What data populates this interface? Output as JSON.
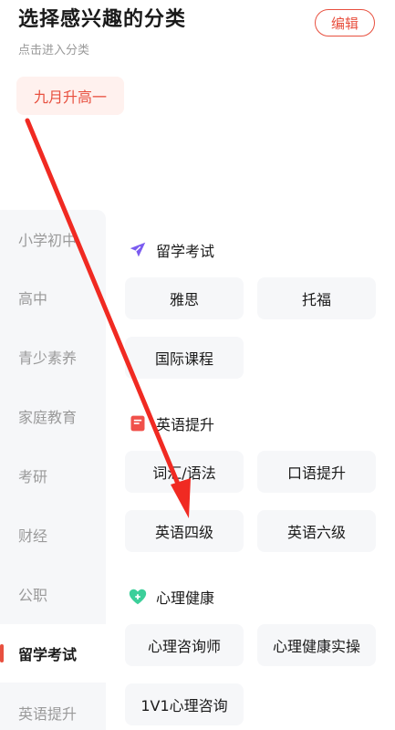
{
  "header": {
    "title": "选择感兴趣的分类",
    "subtitle": "点击进入分类",
    "edit_label": "编辑"
  },
  "selected": {
    "label": "九月升高一"
  },
  "sidebar": {
    "items": [
      {
        "label": "小学初中"
      },
      {
        "label": "高中"
      },
      {
        "label": "青少素养"
      },
      {
        "label": "家庭教育"
      },
      {
        "label": "考研"
      },
      {
        "label": "财经"
      },
      {
        "label": "公职"
      },
      {
        "label": "留学考试",
        "active": true
      },
      {
        "label": "英语提升"
      }
    ]
  },
  "sections": [
    {
      "title": "留学考试",
      "icon": "airplane-icon",
      "icon_color": "#7b5cf0",
      "chips": [
        "雅思",
        "托福",
        "国际课程"
      ]
    },
    {
      "title": "英语提升",
      "icon": "book-icon",
      "icon_color": "#f0504a",
      "chips": [
        "词汇/语法",
        "口语提升",
        "英语四级",
        "英语六级"
      ]
    },
    {
      "title": "心理健康",
      "icon": "heart-icon",
      "icon_color": "#3ccf9a",
      "chips": [
        "心理咨询师",
        "心理健康实操",
        "1V1心理咨询"
      ]
    }
  ],
  "colors": {
    "accent": "#e8503f",
    "annotation_arrow": "#f02a22"
  }
}
